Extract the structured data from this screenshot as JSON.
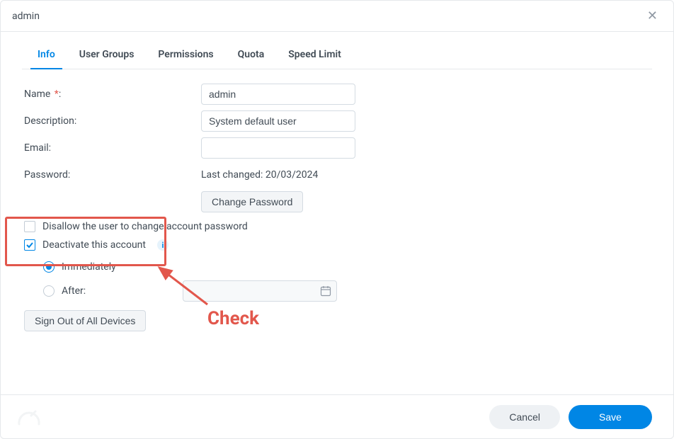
{
  "window_title": "admin",
  "tabs": [
    {
      "label": "Info",
      "active": true
    },
    {
      "label": "User Groups"
    },
    {
      "label": "Permissions"
    },
    {
      "label": "Quota"
    },
    {
      "label": "Speed Limit"
    }
  ],
  "form": {
    "name_label": "Name",
    "name_value": "admin",
    "desc_label": "Description:",
    "desc_value": "System default user",
    "email_label": "Email:",
    "email_value": "",
    "password_label": "Password:",
    "password_status": "Last changed: 20/03/2024",
    "change_password_btn": "Change Password",
    "disallow_label": "Disallow the user to change account password",
    "disallow_checked": false,
    "deactivate_label": "Deactivate this account",
    "deactivate_checked": true,
    "radio_immediately": "Immediately",
    "radio_after": "After:",
    "radio_selected": "immediately",
    "date_value": "",
    "signout_btn": "Sign Out of All Devices"
  },
  "footer": {
    "cancel": "Cancel",
    "save": "Save"
  },
  "annotation": {
    "text": "Check"
  }
}
